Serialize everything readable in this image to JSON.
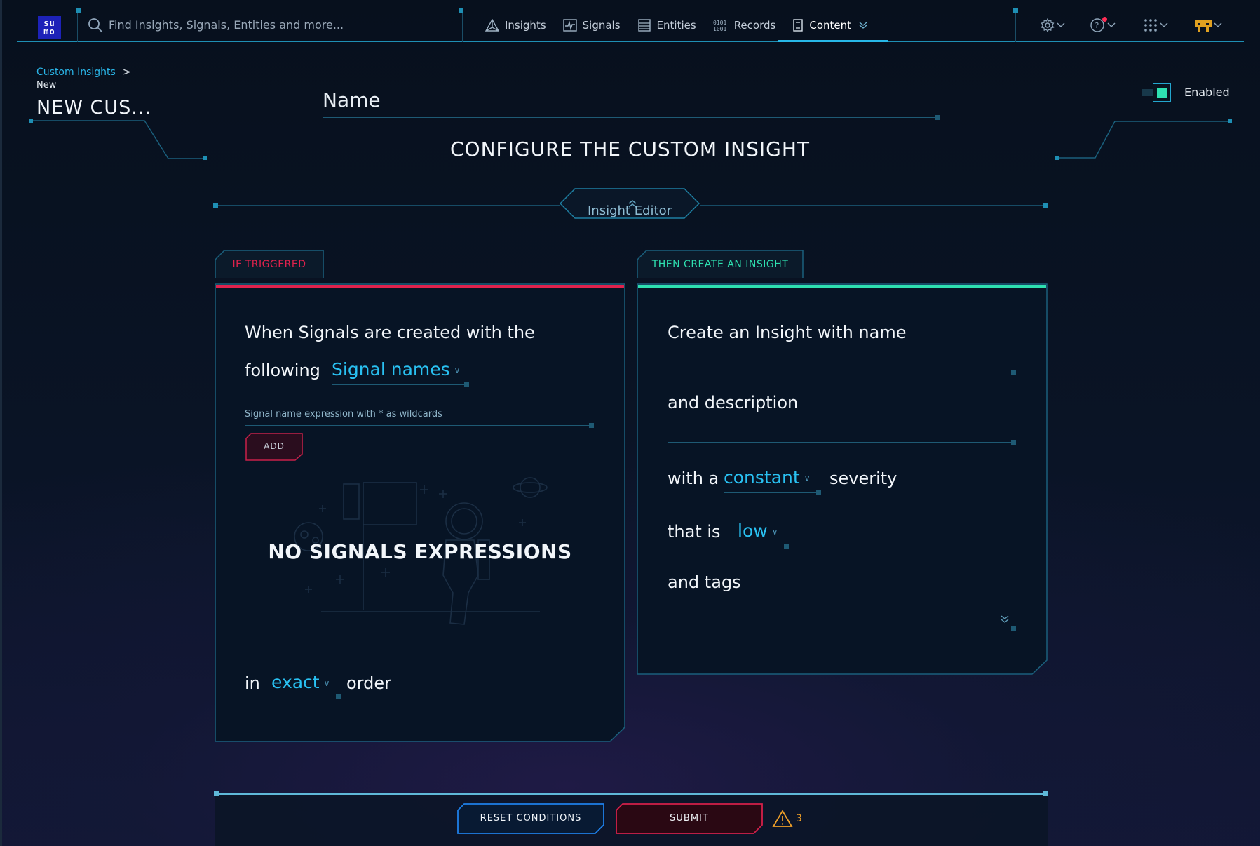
{
  "app": {
    "logo_text_top": "su",
    "logo_text_bottom": "mo",
    "logo_color": "#1d22b8",
    "accent": "#27b8e8",
    "trigger_color": "#e0224d",
    "insight_color": "#2ee0b0"
  },
  "search": {
    "placeholder": "Find Insights, Signals, Entities and more...",
    "icon": "search-icon"
  },
  "nav": [
    {
      "label": "Insights",
      "icon": "triangle-icon"
    },
    {
      "label": "Signals",
      "icon": "pulse-icon"
    },
    {
      "label": "Entities",
      "icon": "stack-icon"
    },
    {
      "label": "Records",
      "icon": "binary-icon"
    },
    {
      "label": "Content",
      "icon": "document-icon",
      "active": true
    }
  ],
  "utilities": [
    "gear-icon",
    "help-icon",
    "apps-grid-icon",
    "user-avatar-icon"
  ],
  "breadcrumb": {
    "parent": "Custom Insights",
    "separator": ">",
    "current": "New"
  },
  "page_title": "NEW CUS...",
  "name_field": {
    "label": "Name",
    "value": ""
  },
  "enabled_toggle": {
    "label": "Enabled",
    "on": true
  },
  "section_title": "CONFIGURE THE CUSTOM INSIGHT",
  "editor_tab": {
    "label": "Insight Editor"
  },
  "trigger_panel": {
    "tab": "IF TRIGGERED",
    "sentence_1": "When Signals are created with the",
    "sentence_2": "following",
    "match_select": "Signal names",
    "expression_placeholder": "Signal name expression with * as wildcards",
    "add_label": "ADD",
    "empty_text": "NO SIGNALS EXPRESSIONS",
    "order_prefix": "in",
    "order_select": "exact",
    "order_suffix": "order"
  },
  "insight_panel": {
    "tab": "THEN CREATE AN INSIGHT",
    "name_text": "Create an Insight with name",
    "desc_text": "and description",
    "severity_prefix": "with a",
    "severity_type": "constant",
    "severity_suffix": "severity",
    "level_prefix": "that is",
    "level_value": "low",
    "tags_text": "and tags"
  },
  "footer": {
    "reset_label": "RESET CONDITIONS",
    "submit_label": "SUBMIT",
    "warning_count": "3"
  }
}
